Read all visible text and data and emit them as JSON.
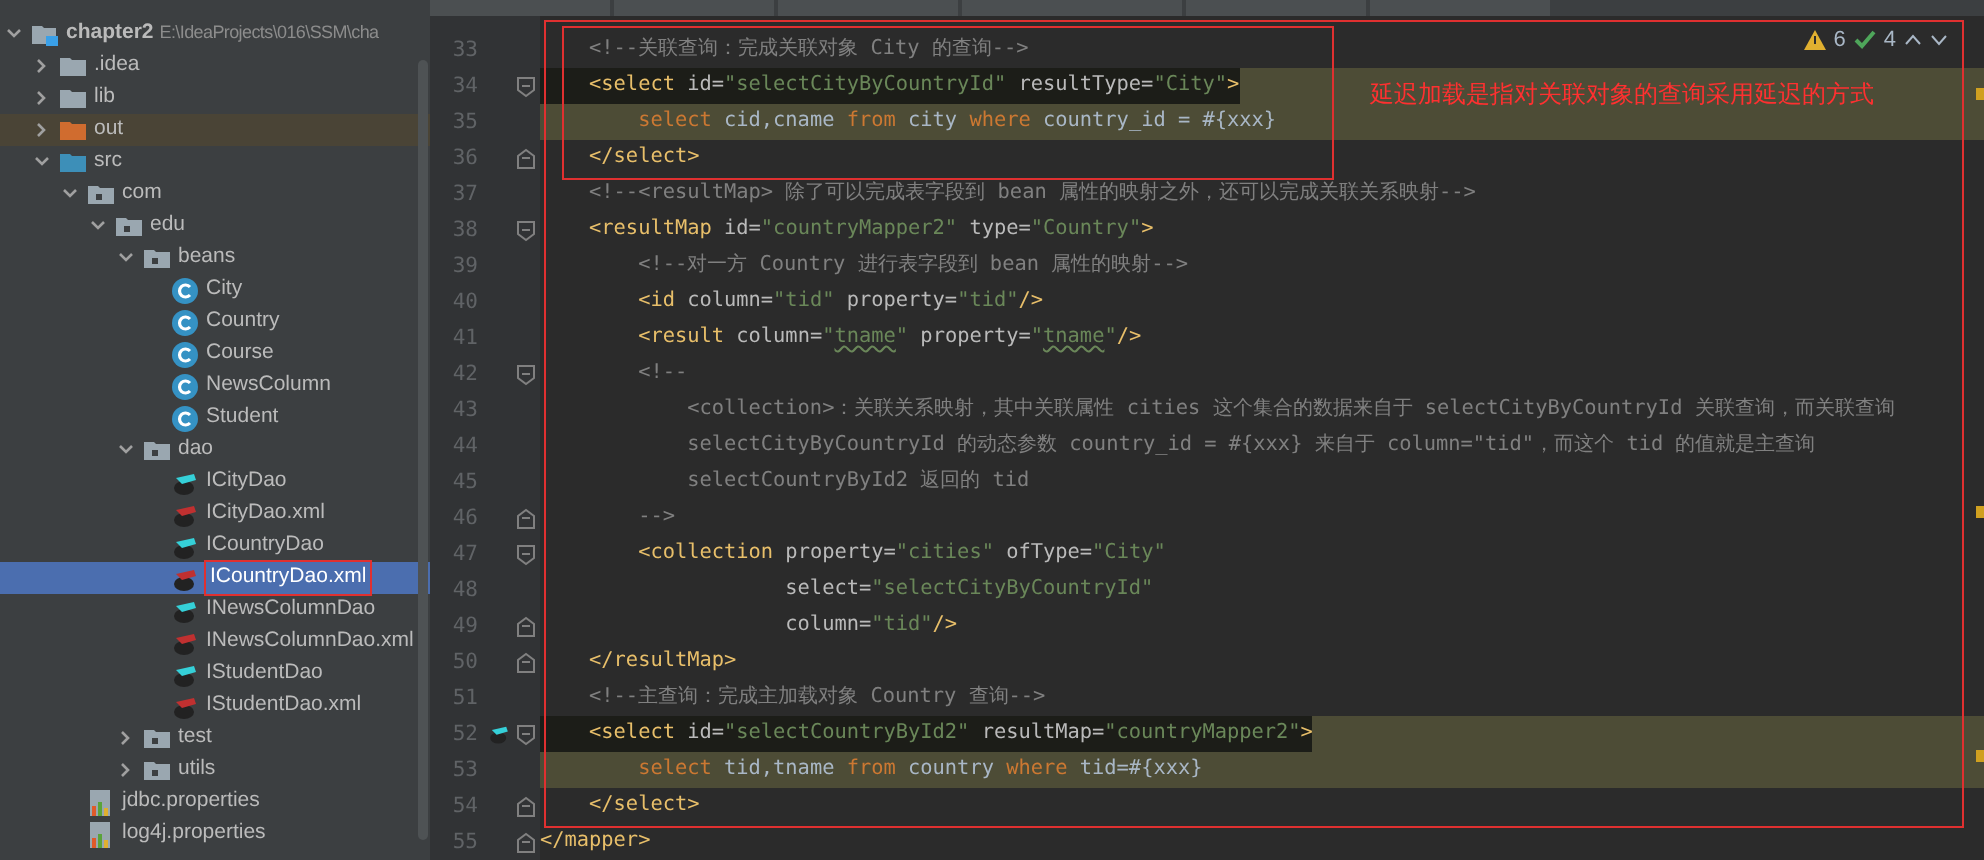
{
  "project_tree": [
    {
      "label": "chapter2",
      "path": "E:\\IdeaProjects\\016\\SSM\\cha",
      "kind": "module",
      "expanded": true,
      "selected": false,
      "boxed": false,
      "children": [
        {
          "label": ".idea",
          "kind": "folder",
          "expanded": false,
          "selected": false,
          "boxed": false
        },
        {
          "label": "lib",
          "kind": "folder",
          "expanded": false,
          "selected": false,
          "boxed": false
        },
        {
          "label": "out",
          "kind": "excluded",
          "expanded": false,
          "selected": false,
          "boxed": false
        },
        {
          "label": "src",
          "kind": "source",
          "expanded": true,
          "selected": false,
          "boxed": false,
          "children": [
            {
              "label": "com",
              "kind": "package",
              "expanded": true,
              "selected": false,
              "boxed": false,
              "children": [
                {
                  "label": "edu",
                  "kind": "package",
                  "expanded": true,
                  "selected": false,
                  "boxed": false,
                  "children": [
                    {
                      "label": "beans",
                      "kind": "package",
                      "expanded": true,
                      "selected": false,
                      "boxed": false,
                      "children": [
                        {
                          "label": "City",
                          "kind": "class",
                          "selected": false,
                          "boxed": false
                        },
                        {
                          "label": "Country",
                          "kind": "class",
                          "selected": false,
                          "boxed": false
                        },
                        {
                          "label": "Course",
                          "kind": "class",
                          "selected": false,
                          "boxed": false
                        },
                        {
                          "label": "NewsColumn",
                          "kind": "class",
                          "selected": false,
                          "boxed": false
                        },
                        {
                          "label": "Student",
                          "kind": "class",
                          "selected": false,
                          "boxed": false
                        }
                      ]
                    },
                    {
                      "label": "dao",
                      "kind": "package",
                      "expanded": true,
                      "selected": false,
                      "boxed": false,
                      "children": [
                        {
                          "label": "ICityDao",
                          "kind": "mapper",
                          "selected": false,
                          "boxed": false
                        },
                        {
                          "label": "ICityDao.xml",
                          "kind": "mapperxml",
                          "selected": false,
                          "boxed": false
                        },
                        {
                          "label": "ICountryDao",
                          "kind": "mapper",
                          "selected": false,
                          "boxed": false
                        },
                        {
                          "label": "ICountryDao.xml",
                          "kind": "mapperxml",
                          "selected": true,
                          "boxed": true
                        },
                        {
                          "label": "INewsColumnDao",
                          "kind": "mapper",
                          "selected": false,
                          "boxed": false
                        },
                        {
                          "label": "INewsColumnDao.xml",
                          "kind": "mapperxml",
                          "selected": false,
                          "boxed": false
                        },
                        {
                          "label": "IStudentDao",
                          "kind": "mapper",
                          "selected": false,
                          "boxed": false
                        },
                        {
                          "label": "IStudentDao.xml",
                          "kind": "mapperxml",
                          "selected": false,
                          "boxed": false
                        }
                      ]
                    },
                    {
                      "label": "test",
                      "kind": "package",
                      "expanded": false,
                      "selected": false,
                      "boxed": false
                    },
                    {
                      "label": "utils",
                      "kind": "package",
                      "expanded": false,
                      "selected": false,
                      "boxed": false
                    }
                  ]
                }
              ]
            },
            {
              "label": "jdbc.properties",
              "kind": "properties",
              "selected": false,
              "boxed": false
            },
            {
              "label": "log4j.properties",
              "kind": "properties",
              "selected": false,
              "boxed": false
            }
          ]
        }
      ]
    }
  ],
  "inspections": {
    "warnings": "6",
    "passed": "4"
  },
  "annotation": "延迟加载是指对关联对象的查询采用延迟的方式",
  "code_lines": [
    {
      "number": "33",
      "line_highlighted": false,
      "tag_highlighted": false,
      "fold_start": false,
      "fold_end": false,
      "mapper_icon": false,
      "tokens": [
        {
          "kind": "comment",
          "text": "    <!--关联查询：完成关联对象 City 的查询-->"
        }
      ]
    },
    {
      "number": "34",
      "line_highlighted": true,
      "tag_highlighted": true,
      "fold_start": true,
      "fold_end": false,
      "mapper_icon": false,
      "tokens": [
        {
          "kind": "tag",
          "text": "    <select"
        },
        {
          "kind": "attr",
          "text": " id="
        },
        {
          "kind": "str",
          "text": "\"selectCityByCountryId\""
        },
        {
          "kind": "attr",
          "text": " resultType="
        },
        {
          "kind": "str",
          "text": "\"City\""
        },
        {
          "kind": "tag",
          "text": ">"
        }
      ]
    },
    {
      "number": "35",
      "line_highlighted": true,
      "tag_highlighted": false,
      "fold_start": false,
      "fold_end": false,
      "mapper_icon": false,
      "tokens": [
        {
          "kind": "kw",
          "text": "        select"
        },
        {
          "kind": "plain",
          "text": " cid,cname "
        },
        {
          "kind": "kw",
          "text": "from"
        },
        {
          "kind": "plain",
          "text": " city "
        },
        {
          "kind": "kw",
          "text": "where"
        },
        {
          "kind": "plain",
          "text": " country_id = #{xxx}"
        }
      ]
    },
    {
      "number": "36",
      "line_highlighted": false,
      "tag_highlighted": false,
      "fold_start": false,
      "fold_end": true,
      "mapper_icon": false,
      "tokens": [
        {
          "kind": "tag",
          "text": "    </select>"
        }
      ]
    },
    {
      "number": "37",
      "line_highlighted": false,
      "tag_highlighted": false,
      "fold_start": false,
      "fold_end": false,
      "mapper_icon": false,
      "tokens": [
        {
          "kind": "comment",
          "text": "    <!--<resultMap> 除了可以完成表字段到 bean 属性的映射之外，还可以完成关联关系映射-->"
        }
      ]
    },
    {
      "number": "38",
      "line_highlighted": false,
      "tag_highlighted": false,
      "fold_start": true,
      "fold_end": false,
      "mapper_icon": false,
      "tokens": [
        {
          "kind": "tag",
          "text": "    <resultMap"
        },
        {
          "kind": "attr",
          "text": " id="
        },
        {
          "kind": "str",
          "text": "\"countryMapper2\""
        },
        {
          "kind": "attr",
          "text": " type="
        },
        {
          "kind": "str",
          "text": "\"Country\""
        },
        {
          "kind": "tag",
          "text": ">"
        }
      ]
    },
    {
      "number": "39",
      "line_highlighted": false,
      "tag_highlighted": false,
      "fold_start": false,
      "fold_end": false,
      "mapper_icon": false,
      "tokens": [
        {
          "kind": "comment",
          "text": "        <!--对一方 Country 进行表字段到 bean 属性的映射-->"
        }
      ]
    },
    {
      "number": "40",
      "line_highlighted": false,
      "tag_highlighted": false,
      "fold_start": false,
      "fold_end": false,
      "mapper_icon": false,
      "tokens": [
        {
          "kind": "tag",
          "text": "        <id"
        },
        {
          "kind": "attr",
          "text": " column="
        },
        {
          "kind": "str",
          "text": "\"tid\""
        },
        {
          "kind": "attr",
          "text": " property="
        },
        {
          "kind": "str",
          "text": "\"tid\""
        },
        {
          "kind": "tag",
          "text": "/>"
        }
      ]
    },
    {
      "number": "41",
      "line_highlighted": false,
      "tag_highlighted": false,
      "fold_start": false,
      "fold_end": false,
      "mapper_icon": false,
      "tokens": [
        {
          "kind": "tag",
          "text": "        <result"
        },
        {
          "kind": "attr",
          "text": " column="
        },
        {
          "kind": "str",
          "text": "\""
        },
        {
          "kind": "typo",
          "text": "tname"
        },
        {
          "kind": "str",
          "text": "\""
        },
        {
          "kind": "attr",
          "text": " property="
        },
        {
          "kind": "str",
          "text": "\""
        },
        {
          "kind": "typo",
          "text": "tname"
        },
        {
          "kind": "str",
          "text": "\""
        },
        {
          "kind": "tag",
          "text": "/>"
        }
      ]
    },
    {
      "number": "42",
      "line_highlighted": false,
      "tag_highlighted": false,
      "fold_start": true,
      "fold_end": false,
      "mapper_icon": false,
      "tokens": [
        {
          "kind": "comment",
          "text": "        <!--"
        }
      ]
    },
    {
      "number": "43",
      "line_highlighted": false,
      "tag_highlighted": false,
      "fold_start": false,
      "fold_end": false,
      "mapper_icon": false,
      "tokens": [
        {
          "kind": "comment",
          "text": "            <collection>：关联关系映射，其中关联属性 cities 这个集合的数据来自于 selectCityByCountryId 关联查询，而关联查询"
        }
      ]
    },
    {
      "number": "44",
      "line_highlighted": false,
      "tag_highlighted": false,
      "fold_start": false,
      "fold_end": false,
      "mapper_icon": false,
      "tokens": [
        {
          "kind": "comment",
          "text": "            selectCityByCountryId 的动态参数 country_id = #{xxx} 来自于 column=\"tid\"，而这个 tid 的值就是主查询"
        }
      ]
    },
    {
      "number": "45",
      "line_highlighted": false,
      "tag_highlighted": false,
      "fold_start": false,
      "fold_end": false,
      "mapper_icon": false,
      "tokens": [
        {
          "kind": "comment",
          "text": "            selectCountryById2 返回的 tid"
        }
      ]
    },
    {
      "number": "46",
      "line_highlighted": false,
      "tag_highlighted": false,
      "fold_start": false,
      "fold_end": true,
      "mapper_icon": false,
      "tokens": [
        {
          "kind": "comment",
          "text": "        -->"
        }
      ]
    },
    {
      "number": "47",
      "line_highlighted": false,
      "tag_highlighted": false,
      "fold_start": true,
      "fold_end": false,
      "mapper_icon": false,
      "tokens": [
        {
          "kind": "tag",
          "text": "        <collection"
        },
        {
          "kind": "attr",
          "text": " property="
        },
        {
          "kind": "str",
          "text": "\"cities\""
        },
        {
          "kind": "attr",
          "text": " ofType="
        },
        {
          "kind": "str",
          "text": "\"City\""
        }
      ]
    },
    {
      "number": "48",
      "line_highlighted": false,
      "tag_highlighted": false,
      "fold_start": false,
      "fold_end": false,
      "mapper_icon": false,
      "tokens": [
        {
          "kind": "attr",
          "text": "                    select="
        },
        {
          "kind": "str",
          "text": "\"selectCityByCountryId\""
        }
      ]
    },
    {
      "number": "49",
      "line_highlighted": false,
      "tag_highlighted": false,
      "fold_start": false,
      "fold_end": true,
      "mapper_icon": false,
      "tokens": [
        {
          "kind": "attr",
          "text": "                    column="
        },
        {
          "kind": "str",
          "text": "\"tid\""
        },
        {
          "kind": "tag",
          "text": "/>"
        }
      ]
    },
    {
      "number": "50",
      "line_highlighted": false,
      "tag_highlighted": false,
      "fold_start": false,
      "fold_end": true,
      "mapper_icon": false,
      "tokens": [
        {
          "kind": "tag",
          "text": "    </resultMap>"
        }
      ]
    },
    {
      "number": "51",
      "line_highlighted": false,
      "tag_highlighted": false,
      "fold_start": false,
      "fold_end": false,
      "mapper_icon": false,
      "tokens": [
        {
          "kind": "comment",
          "text": "    <!--主查询：完成主加载对象 Country 查询-->"
        }
      ]
    },
    {
      "number": "52",
      "line_highlighted": true,
      "tag_highlighted": true,
      "fold_start": true,
      "fold_end": false,
      "mapper_icon": true,
      "tokens": [
        {
          "kind": "tag",
          "text": "    <select"
        },
        {
          "kind": "attr",
          "text": " id="
        },
        {
          "kind": "str",
          "text": "\"selectCountryById2\""
        },
        {
          "kind": "attr",
          "text": " resultMap="
        },
        {
          "kind": "str",
          "text": "\"countryMapper2\""
        },
        {
          "kind": "tag",
          "text": ">"
        }
      ]
    },
    {
      "number": "53",
      "line_highlighted": true,
      "tag_highlighted": false,
      "fold_start": false,
      "fold_end": false,
      "mapper_icon": false,
      "tokens": [
        {
          "kind": "kw",
          "text": "        select"
        },
        {
          "kind": "plain",
          "text": " tid,tname "
        },
        {
          "kind": "kw",
          "text": "from"
        },
        {
          "kind": "plain",
          "text": " country "
        },
        {
          "kind": "kw",
          "text": "where"
        },
        {
          "kind": "plain",
          "text": " tid=#{xxx}"
        }
      ]
    },
    {
      "number": "54",
      "line_highlighted": false,
      "tag_highlighted": false,
      "fold_start": false,
      "fold_end": true,
      "mapper_icon": false,
      "tokens": [
        {
          "kind": "tag",
          "text": "    </select>"
        }
      ]
    },
    {
      "number": "55",
      "line_highlighted": false,
      "tag_highlighted": false,
      "fold_start": false,
      "fold_end": true,
      "mapper_icon": false,
      "tokens": [
        {
          "kind": "tag",
          "text": "</mapper>"
        }
      ]
    }
  ]
}
